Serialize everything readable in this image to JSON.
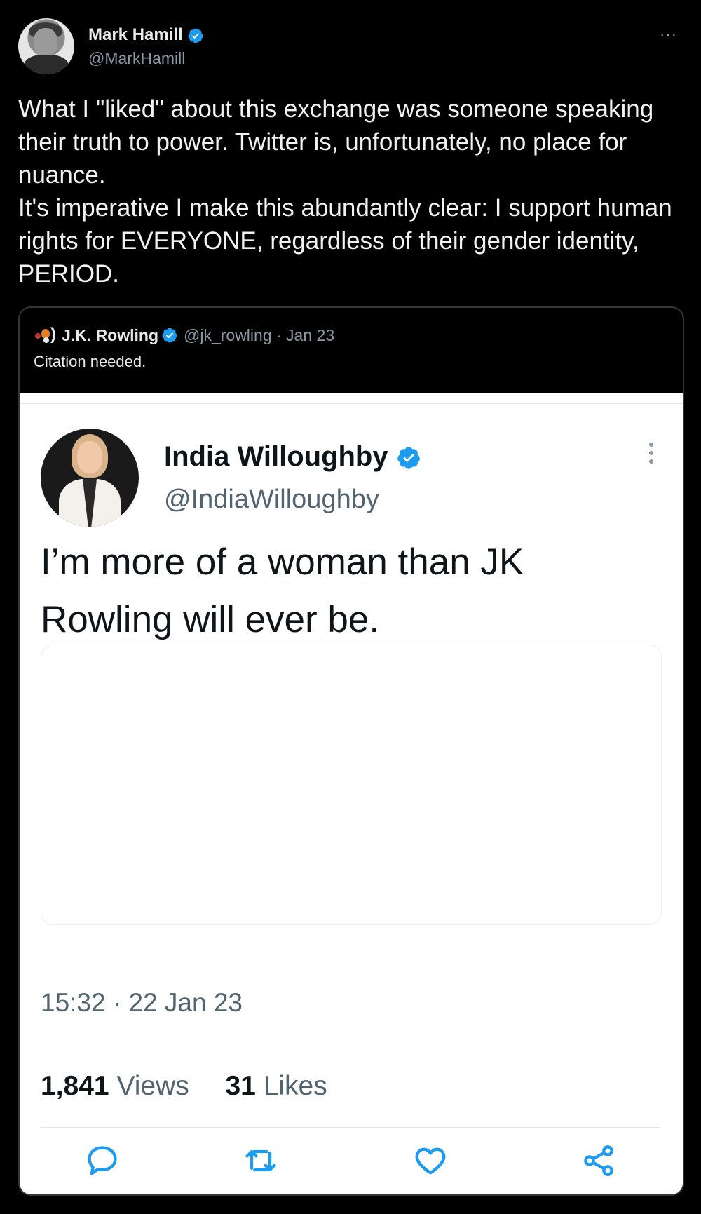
{
  "tweet": {
    "author_name": "Mark Hamill",
    "author_handle": "@MarkHamill",
    "more_label": "···",
    "text_paragraphs": [
      "What I \"liked\" about this exchange was someone speaking their truth to power. Twitter is, unfortunately, no place for nuance.",
      "It's imperative I make this abundantly clear: I support human rights for EVERYONE, regardless of their gender identity, PERIOD."
    ]
  },
  "quoted": {
    "author_name": "J.K. Rowling",
    "handle_date": "@jk_rowling · Jan 23",
    "text": "Citation needed."
  },
  "embedded": {
    "author_name": "India Willoughby",
    "author_handle": "@IndiaWilloughby",
    "text": "I’m more of a woman than JK Rowling will ever be.",
    "timestamp": "15:32 · 22 Jan 23",
    "views_count": "1,841",
    "views_label": "Views",
    "likes_count": "31",
    "likes_label": "Likes"
  },
  "icons": {
    "verified": "verified-badge-icon",
    "more": "more-options-icon",
    "reply": "reply-icon",
    "retweet": "retweet-icon",
    "like": "heart-icon",
    "share": "share-icon"
  },
  "colors": {
    "background": "#000000",
    "text_primary": "#e7e9ea",
    "text_secondary": "#8b98a5",
    "verified_blue": "#1d9bf0",
    "embed_background": "#ffffff",
    "embed_icon_blue": "#1d9bf0"
  }
}
